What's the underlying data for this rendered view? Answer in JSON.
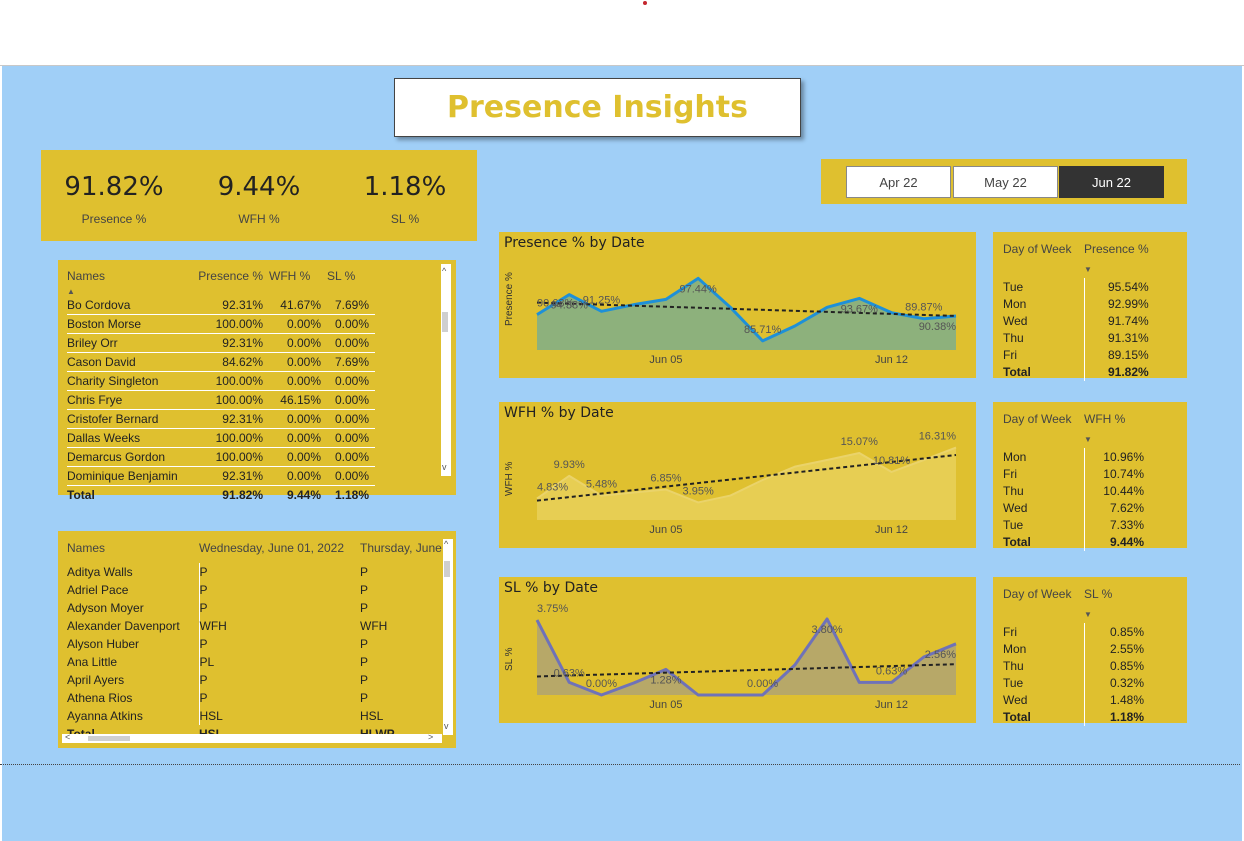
{
  "report": {
    "title": "Presence Insights"
  },
  "kpis": [
    {
      "value": "91.82%",
      "label": "Presence %"
    },
    {
      "value": "9.44%",
      "label": "WFH %"
    },
    {
      "value": "1.18%",
      "label": "SL %"
    }
  ],
  "month_slicer": {
    "options": [
      "Apr 22",
      "May 22",
      "Jun 22"
    ],
    "selected": "Jun 22"
  },
  "names_table": {
    "headers": [
      "Names",
      "Presence %",
      "WFH %",
      "SL %"
    ],
    "rows": [
      [
        "Bo Cordova",
        "92.31%",
        "41.67%",
        "7.69%"
      ],
      [
        "Boston Morse",
        "100.00%",
        "0.00%",
        "0.00%"
      ],
      [
        "Briley Orr",
        "92.31%",
        "0.00%",
        "0.00%"
      ],
      [
        "Cason David",
        "84.62%",
        "0.00%",
        "7.69%"
      ],
      [
        "Charity Singleton",
        "100.00%",
        "0.00%",
        "0.00%"
      ],
      [
        "Chris Frye",
        "100.00%",
        "46.15%",
        "0.00%"
      ],
      [
        "Cristofer Bernard",
        "92.31%",
        "0.00%",
        "0.00%"
      ],
      [
        "Dallas Weeks",
        "100.00%",
        "0.00%",
        "0.00%"
      ],
      [
        "Demarcus Gordon",
        "100.00%",
        "0.00%",
        "0.00%"
      ],
      [
        "Dominique Benjamin",
        "92.31%",
        "0.00%",
        "0.00%"
      ]
    ],
    "total": [
      "Total",
      "91.82%",
      "9.44%",
      "1.18%"
    ]
  },
  "status_matrix": {
    "headers": [
      "Names",
      "Wednesday, June 01, 2022",
      "Thursday, June"
    ],
    "rows": [
      [
        "Aditya Walls",
        "P",
        "P"
      ],
      [
        "Adriel Pace",
        "P",
        "P"
      ],
      [
        "Adyson Moyer",
        "P",
        "P"
      ],
      [
        "Alexander Davenport",
        "WFH",
        "WFH"
      ],
      [
        "Alyson Huber",
        "P",
        "P"
      ],
      [
        "Ana Little",
        "PL",
        "P"
      ],
      [
        "April Ayers",
        "P",
        "P"
      ],
      [
        "Athena Rios",
        "P",
        "P"
      ],
      [
        "Ayanna Atkins",
        "HSL",
        "HSL"
      ]
    ],
    "total": [
      "Total",
      "HSL",
      "HLWP"
    ]
  },
  "dow_presence": {
    "headers": [
      "Day of Week",
      "Presence %"
    ],
    "rows": [
      [
        "Tue",
        "95.54%"
      ],
      [
        "Mon",
        "92.99%"
      ],
      [
        "Wed",
        "91.74%"
      ],
      [
        "Thu",
        "91.31%"
      ],
      [
        "Fri",
        "89.15%"
      ]
    ],
    "total": [
      "Total",
      "91.82%"
    ]
  },
  "dow_wfh": {
    "headers": [
      "Day of Week",
      "WFH %"
    ],
    "rows": [
      [
        "Mon",
        "10.96%"
      ],
      [
        "Fri",
        "10.74%"
      ],
      [
        "Thu",
        "10.44%"
      ],
      [
        "Wed",
        "7.62%"
      ],
      [
        "Tue",
        "7.33%"
      ]
    ],
    "total": [
      "Total",
      "9.44%"
    ]
  },
  "dow_sl": {
    "headers": [
      "Day of Week",
      "SL %"
    ],
    "rows": [
      [
        "Fri",
        "0.85%"
      ],
      [
        "Mon",
        "2.55%"
      ],
      [
        "Thu",
        "0.85%"
      ],
      [
        "Tue",
        "0.32%"
      ],
      [
        "Wed",
        "1.48%"
      ]
    ],
    "total": [
      "Total",
      "1.18%"
    ]
  },
  "colors": {
    "gold": "#dfc02f",
    "canvas": "#a0cff7",
    "presence_line": "#1e90d8",
    "sl_line": "#6f72b8"
  },
  "chart_data": [
    {
      "type": "area",
      "title": "Presence % by Date",
      "ylabel": "Presence %",
      "x_ticks": [
        "Jun 05",
        "Jun 12"
      ],
      "trendline": true,
      "values": [
        90.63,
        94.38,
        91.25,
        92.5,
        93.5,
        97.44,
        92.0,
        85.71,
        88.5,
        92.0,
        93.67,
        91.0,
        89.87,
        90.38
      ],
      "labels": [
        {
          "i": 0,
          "text": "90.63%"
        },
        {
          "i": 1,
          "text": "94.38%"
        },
        {
          "i": 2,
          "text": "91.25%"
        },
        {
          "i": 5,
          "text": "97.44%"
        },
        {
          "i": 7,
          "text": "85.71%"
        },
        {
          "i": 10,
          "text": "93.67%"
        },
        {
          "i": 12,
          "text": "89.87%"
        },
        {
          "i": 13,
          "text": "90.38%"
        }
      ],
      "ylim": [
        84,
        99
      ]
    },
    {
      "type": "area",
      "title": "WFH % by Date",
      "ylabel": "WFH %",
      "x_ticks": [
        "Jun 05",
        "Jun 12"
      ],
      "trendline": true,
      "values": [
        4.83,
        9.93,
        5.48,
        6.2,
        6.85,
        3.95,
        5.5,
        9.0,
        12.0,
        13.5,
        15.07,
        10.81,
        13.5,
        16.31
      ],
      "labels": [
        {
          "i": 0,
          "text": "4.83%"
        },
        {
          "i": 1,
          "text": "9.93%"
        },
        {
          "i": 2,
          "text": "5.48%"
        },
        {
          "i": 4,
          "text": "6.85%"
        },
        {
          "i": 5,
          "text": "3.95%"
        },
        {
          "i": 10,
          "text": "15.07%"
        },
        {
          "i": 11,
          "text": "10.81%"
        },
        {
          "i": 13,
          "text": "16.31%"
        }
      ],
      "ylim": [
        0,
        18
      ]
    },
    {
      "type": "area",
      "title": "SL % by Date",
      "ylabel": "SL %",
      "x_ticks": [
        "Jun 05",
        "Jun 12"
      ],
      "trendline": true,
      "values": [
        3.75,
        0.63,
        0.0,
        0.6,
        1.28,
        0.0,
        0.0,
        0.0,
        1.5,
        3.8,
        0.63,
        0.63,
        1.9,
        2.56
      ],
      "labels": [
        {
          "i": 0,
          "text": "3.75%"
        },
        {
          "i": 1,
          "text": "0.63%"
        },
        {
          "i": 2,
          "text": "0.00%"
        },
        {
          "i": 4,
          "text": "1.28%"
        },
        {
          "i": 7,
          "text": "0.00%"
        },
        {
          "i": 9,
          "text": "3.80%"
        },
        {
          "i": 11,
          "text": "0.63%"
        },
        {
          "i": 13,
          "text": "2.56%"
        }
      ],
      "ylim": [
        0,
        4
      ]
    }
  ]
}
